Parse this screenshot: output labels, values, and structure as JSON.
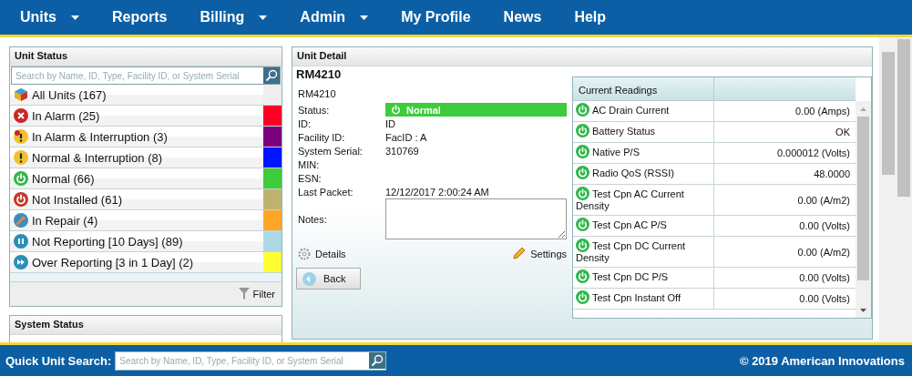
{
  "nav": [
    {
      "label": "Units",
      "has_menu": true
    },
    {
      "label": "Reports",
      "has_menu": false
    },
    {
      "label": "Billing",
      "has_menu": true
    },
    {
      "label": "Admin",
      "has_menu": true
    },
    {
      "label": "My Profile",
      "has_menu": false
    },
    {
      "label": "News",
      "has_menu": false
    },
    {
      "label": "Help",
      "has_menu": false
    }
  ],
  "unit_status": {
    "title": "Unit Status",
    "search_placeholder": "Search by Name, ID, Type, Facility ID, or System Serial",
    "items": [
      {
        "kind": "all",
        "label": "All Units (167)",
        "color": "#eeeeee"
      },
      {
        "kind": "alarm",
        "label": "In Alarm (25)",
        "color": "#ff0022"
      },
      {
        "kind": "alarm-interruption",
        "label": "In Alarm & Interruption (3)",
        "color": "#7a0080"
      },
      {
        "kind": "interruption",
        "label": "Normal & Interruption (8)",
        "color": "#0015ff"
      },
      {
        "kind": "normal",
        "label": "Normal (66)",
        "color": "#3ccc3c"
      },
      {
        "kind": "not-installed",
        "label": "Not Installed (61)",
        "color": "#bdb36e"
      },
      {
        "kind": "repair",
        "label": "In Repair (4)",
        "color": "#ffa626"
      },
      {
        "kind": "not-reporting",
        "label": "Not Reporting [10 Days] (89)",
        "color": "#add8e6"
      },
      {
        "kind": "over-reporting",
        "label": "Over Reporting [3 in 1 Day] (2)",
        "color": "#ffff33"
      }
    ],
    "filter": "Filter"
  },
  "system_status": {
    "title": "System Status"
  },
  "unit_detail": {
    "title": "Unit Detail",
    "name": "RM4210",
    "subname": "RM4210",
    "status": {
      "label": "Status:",
      "kind": "normal",
      "value": "Normal"
    },
    "fields": [
      {
        "label": "ID:",
        "value": "ID"
      },
      {
        "label": "Facility ID:",
        "value": "FacID : A"
      },
      {
        "label": "System Serial:",
        "value": "310769"
      },
      {
        "label": "MIN:"
      },
      {
        "label": "ESN:"
      },
      {
        "label": "Last Packet:",
        "value": "12/12/2017 2:00:24 AM"
      }
    ],
    "notes_label": "Notes:",
    "details": "Details",
    "settings": "Settings",
    "back": "Back",
    "readings": {
      "title": "Current Readings",
      "rows": [
        {
          "kind": "normal",
          "name": "AC Drain Current",
          "value": "0.00 (Amps)"
        },
        {
          "kind": "normal",
          "name": "Battery Status",
          "value": "OK"
        },
        {
          "kind": "normal",
          "name": "Native P/S",
          "value": "0.000012 (Volts)"
        },
        {
          "kind": "normal",
          "name": "Radio QoS (RSSI)",
          "value": "48.0000"
        },
        {
          "kind": "normal",
          "name": "Test Cpn AC Current Density",
          "value": "0.00 (A/m2)"
        },
        {
          "kind": "normal",
          "name": "Test Cpn AC P/S",
          "value": "0.00 (Volts)"
        },
        {
          "kind": "normal",
          "name": "Test Cpn DC Current Density",
          "value": "0.00 (A/m2)"
        },
        {
          "kind": "normal",
          "name": "Test Cpn DC P/S",
          "value": "0.00 (Volts)"
        },
        {
          "kind": "normal",
          "name": "Test Cpn Instant Off",
          "value": "0.00 (Volts)"
        }
      ]
    }
  },
  "footer": {
    "quick_search_label": "Quick Unit Search:",
    "search_placeholder": "Search by Name, ID, Type, Facility ID, or System Serial",
    "copyright": "© 2019 American Innovations"
  }
}
